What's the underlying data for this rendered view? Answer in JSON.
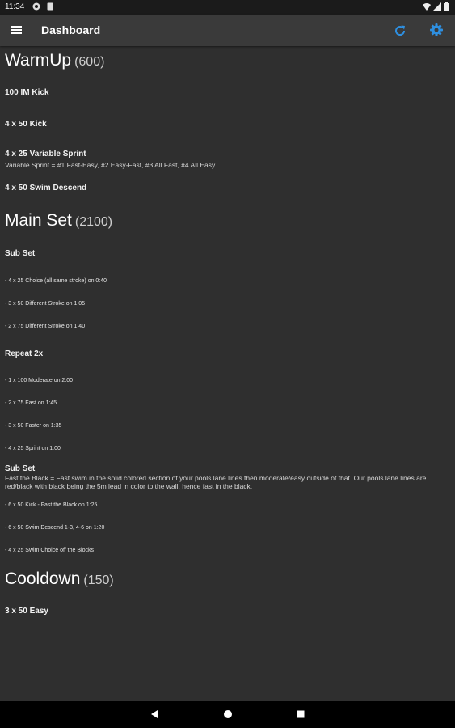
{
  "status_bar": {
    "time": "11:34"
  },
  "app_bar": {
    "title": "Dashboard"
  },
  "sections": {
    "warmup": {
      "title": "WarmUp",
      "yardage": "(600)",
      "items": [
        "100 IM Kick",
        "4 x 50 Kick",
        "4 x 25 Variable Sprint",
        "4 x 50 Swim Descend"
      ],
      "note": "Variable Sprint = #1 Fast-Easy, #2 Easy-Fast, #3 All Fast, #4 All Easy"
    },
    "main": {
      "title": "Main Set",
      "yardage": "(2100)",
      "subset1": {
        "label": "Sub Set",
        "items": [
          "- 4 x 25 Choice (all same stroke) on 0:40",
          "- 3 x 50 Different Stroke on 1:05",
          "- 2 x 75 Different Stroke on 1:40"
        ]
      },
      "repeat": {
        "label": "Repeat 2x",
        "items": [
          "- 1 x 100 Moderate on 2:00",
          "- 2 x 75 Fast on 1:45",
          "- 3 x 50 Faster on 1:35",
          "- 4 x 25 Sprint on 1:00"
        ]
      },
      "subset2": {
        "label": "Sub Set",
        "description": "Fast the Black = Fast swim in the solid colored section of your pools lane lines then moderate/easy outside of that. Our pools lane lines are red/black with black being the 5m lead in color to the wall, hence fast in the black.",
        "items": [
          "- 6 x 50 Kick - Fast the Black on 1:25",
          "- 6 x 50 Swim Descend 1-3, 4-6 on 1:20",
          "- 4 x 25 Swim Choice off the Blocks"
        ]
      }
    },
    "cooldown": {
      "title": "Cooldown",
      "yardage": "(150)",
      "items": [
        "3 x 50 Easy"
      ]
    }
  },
  "colors": {
    "accent": "#2e8fe0",
    "background": "#2f2f2f",
    "appbar": "#3a3a3a"
  },
  "icons": {
    "menu": "menu-icon",
    "refresh": "refresh-icon",
    "settings": "settings-icon",
    "back": "back-triangle-icon",
    "home": "home-circle-icon",
    "recents": "recents-square-icon"
  }
}
